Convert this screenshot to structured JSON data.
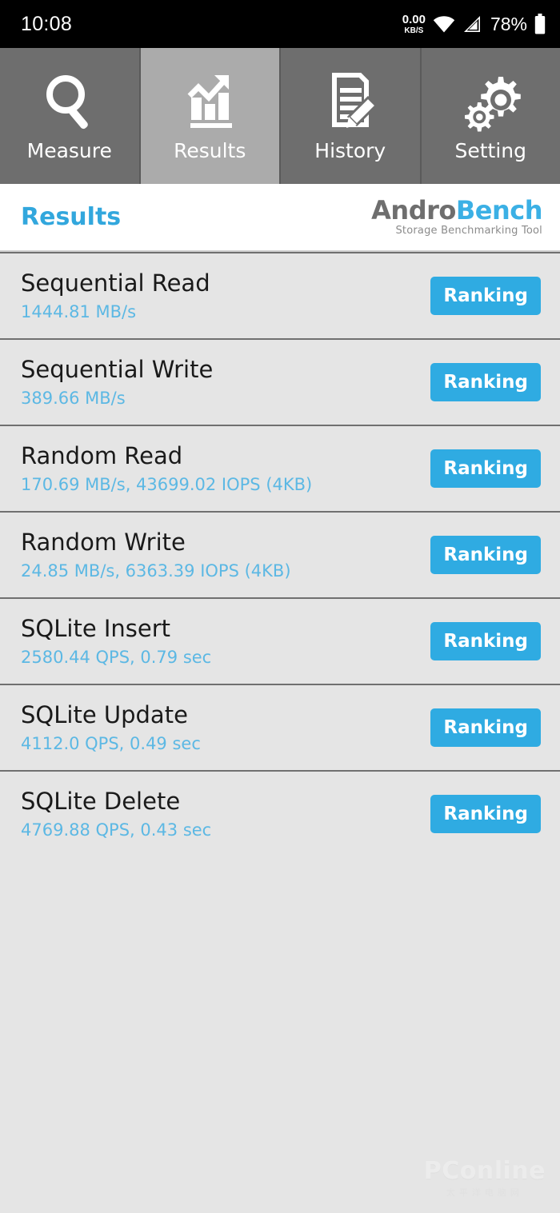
{
  "statusbar": {
    "time": "10:08",
    "data_rate": "0.00",
    "data_unit": "KB/S",
    "battery_percent": "78%",
    "icons": [
      "wifi-icon",
      "cellular-signal-icon",
      "battery-icon"
    ]
  },
  "tabs": [
    {
      "label": "Measure",
      "icon": "magnifier-icon",
      "active": false
    },
    {
      "label": "Results",
      "icon": "bar-chart-icon",
      "active": true
    },
    {
      "label": "History",
      "icon": "document-pencil-icon",
      "active": false
    },
    {
      "label": "Setting",
      "icon": "gears-icon",
      "active": false
    }
  ],
  "header": {
    "title": "Results",
    "logo_primary": "Andro",
    "logo_secondary": "Bench",
    "logo_tagline": "Storage Benchmarking Tool"
  },
  "results": {
    "button_label": "Ranking",
    "rows": [
      {
        "title": "Sequential Read",
        "value": "1444.81 MB/s"
      },
      {
        "title": "Sequential Write",
        "value": "389.66 MB/s"
      },
      {
        "title": "Random Read",
        "value": "170.69 MB/s, 43699.02 IOPS (4KB)"
      },
      {
        "title": "Random Write",
        "value": "24.85 MB/s, 6363.39 IOPS (4KB)"
      },
      {
        "title": "SQLite Insert",
        "value": "2580.44 QPS, 0.79 sec"
      },
      {
        "title": "SQLite Update",
        "value": "4112.0 QPS, 0.49 sec"
      },
      {
        "title": "SQLite Delete",
        "value": "4769.88 QPS, 0.43 sec"
      }
    ]
  },
  "watermark": {
    "text": "PConline",
    "subtext": "太平洋电脑网"
  },
  "colors": {
    "accent_blue": "#2fabe2",
    "value_blue": "#5cb8e4",
    "tab_inactive": "#6e6e6e",
    "tab_active": "#ababab",
    "page_bg": "#e5e5e5",
    "statusbar_bg": "#000000"
  }
}
